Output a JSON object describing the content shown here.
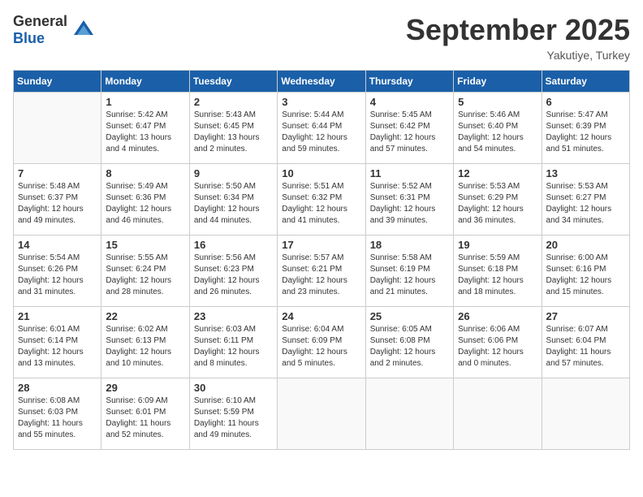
{
  "header": {
    "logo": {
      "general": "General",
      "blue": "Blue"
    },
    "title": "September 2025",
    "subtitle": "Yakutiye, Turkey"
  },
  "calendar": {
    "days_of_week": [
      "Sunday",
      "Monday",
      "Tuesday",
      "Wednesday",
      "Thursday",
      "Friday",
      "Saturday"
    ],
    "weeks": [
      [
        {
          "day": "",
          "sunrise": "",
          "sunset": "",
          "daylight": ""
        },
        {
          "day": "1",
          "sunrise": "Sunrise: 5:42 AM",
          "sunset": "Sunset: 6:47 PM",
          "daylight": "Daylight: 13 hours and 4 minutes."
        },
        {
          "day": "2",
          "sunrise": "Sunrise: 5:43 AM",
          "sunset": "Sunset: 6:45 PM",
          "daylight": "Daylight: 13 hours and 2 minutes."
        },
        {
          "day": "3",
          "sunrise": "Sunrise: 5:44 AM",
          "sunset": "Sunset: 6:44 PM",
          "daylight": "Daylight: 12 hours and 59 minutes."
        },
        {
          "day": "4",
          "sunrise": "Sunrise: 5:45 AM",
          "sunset": "Sunset: 6:42 PM",
          "daylight": "Daylight: 12 hours and 57 minutes."
        },
        {
          "day": "5",
          "sunrise": "Sunrise: 5:46 AM",
          "sunset": "Sunset: 6:40 PM",
          "daylight": "Daylight: 12 hours and 54 minutes."
        },
        {
          "day": "6",
          "sunrise": "Sunrise: 5:47 AM",
          "sunset": "Sunset: 6:39 PM",
          "daylight": "Daylight: 12 hours and 51 minutes."
        }
      ],
      [
        {
          "day": "7",
          "sunrise": "Sunrise: 5:48 AM",
          "sunset": "Sunset: 6:37 PM",
          "daylight": "Daylight: 12 hours and 49 minutes."
        },
        {
          "day": "8",
          "sunrise": "Sunrise: 5:49 AM",
          "sunset": "Sunset: 6:36 PM",
          "daylight": "Daylight: 12 hours and 46 minutes."
        },
        {
          "day": "9",
          "sunrise": "Sunrise: 5:50 AM",
          "sunset": "Sunset: 6:34 PM",
          "daylight": "Daylight: 12 hours and 44 minutes."
        },
        {
          "day": "10",
          "sunrise": "Sunrise: 5:51 AM",
          "sunset": "Sunset: 6:32 PM",
          "daylight": "Daylight: 12 hours and 41 minutes."
        },
        {
          "day": "11",
          "sunrise": "Sunrise: 5:52 AM",
          "sunset": "Sunset: 6:31 PM",
          "daylight": "Daylight: 12 hours and 39 minutes."
        },
        {
          "day": "12",
          "sunrise": "Sunrise: 5:53 AM",
          "sunset": "Sunset: 6:29 PM",
          "daylight": "Daylight: 12 hours and 36 minutes."
        },
        {
          "day": "13",
          "sunrise": "Sunrise: 5:53 AM",
          "sunset": "Sunset: 6:27 PM",
          "daylight": "Daylight: 12 hours and 34 minutes."
        }
      ],
      [
        {
          "day": "14",
          "sunrise": "Sunrise: 5:54 AM",
          "sunset": "Sunset: 6:26 PM",
          "daylight": "Daylight: 12 hours and 31 minutes."
        },
        {
          "day": "15",
          "sunrise": "Sunrise: 5:55 AM",
          "sunset": "Sunset: 6:24 PM",
          "daylight": "Daylight: 12 hours and 28 minutes."
        },
        {
          "day": "16",
          "sunrise": "Sunrise: 5:56 AM",
          "sunset": "Sunset: 6:23 PM",
          "daylight": "Daylight: 12 hours and 26 minutes."
        },
        {
          "day": "17",
          "sunrise": "Sunrise: 5:57 AM",
          "sunset": "Sunset: 6:21 PM",
          "daylight": "Daylight: 12 hours and 23 minutes."
        },
        {
          "day": "18",
          "sunrise": "Sunrise: 5:58 AM",
          "sunset": "Sunset: 6:19 PM",
          "daylight": "Daylight: 12 hours and 21 minutes."
        },
        {
          "day": "19",
          "sunrise": "Sunrise: 5:59 AM",
          "sunset": "Sunset: 6:18 PM",
          "daylight": "Daylight: 12 hours and 18 minutes."
        },
        {
          "day": "20",
          "sunrise": "Sunrise: 6:00 AM",
          "sunset": "Sunset: 6:16 PM",
          "daylight": "Daylight: 12 hours and 15 minutes."
        }
      ],
      [
        {
          "day": "21",
          "sunrise": "Sunrise: 6:01 AM",
          "sunset": "Sunset: 6:14 PM",
          "daylight": "Daylight: 12 hours and 13 minutes."
        },
        {
          "day": "22",
          "sunrise": "Sunrise: 6:02 AM",
          "sunset": "Sunset: 6:13 PM",
          "daylight": "Daylight: 12 hours and 10 minutes."
        },
        {
          "day": "23",
          "sunrise": "Sunrise: 6:03 AM",
          "sunset": "Sunset: 6:11 PM",
          "daylight": "Daylight: 12 hours and 8 minutes."
        },
        {
          "day": "24",
          "sunrise": "Sunrise: 6:04 AM",
          "sunset": "Sunset: 6:09 PM",
          "daylight": "Daylight: 12 hours and 5 minutes."
        },
        {
          "day": "25",
          "sunrise": "Sunrise: 6:05 AM",
          "sunset": "Sunset: 6:08 PM",
          "daylight": "Daylight: 12 hours and 2 minutes."
        },
        {
          "day": "26",
          "sunrise": "Sunrise: 6:06 AM",
          "sunset": "Sunset: 6:06 PM",
          "daylight": "Daylight: 12 hours and 0 minutes."
        },
        {
          "day": "27",
          "sunrise": "Sunrise: 6:07 AM",
          "sunset": "Sunset: 6:04 PM",
          "daylight": "Daylight: 11 hours and 57 minutes."
        }
      ],
      [
        {
          "day": "28",
          "sunrise": "Sunrise: 6:08 AM",
          "sunset": "Sunset: 6:03 PM",
          "daylight": "Daylight: 11 hours and 55 minutes."
        },
        {
          "day": "29",
          "sunrise": "Sunrise: 6:09 AM",
          "sunset": "Sunset: 6:01 PM",
          "daylight": "Daylight: 11 hours and 52 minutes."
        },
        {
          "day": "30",
          "sunrise": "Sunrise: 6:10 AM",
          "sunset": "Sunset: 5:59 PM",
          "daylight": "Daylight: 11 hours and 49 minutes."
        },
        {
          "day": "",
          "sunrise": "",
          "sunset": "",
          "daylight": ""
        },
        {
          "day": "",
          "sunrise": "",
          "sunset": "",
          "daylight": ""
        },
        {
          "day": "",
          "sunrise": "",
          "sunset": "",
          "daylight": ""
        },
        {
          "day": "",
          "sunrise": "",
          "sunset": "",
          "daylight": ""
        }
      ]
    ]
  }
}
